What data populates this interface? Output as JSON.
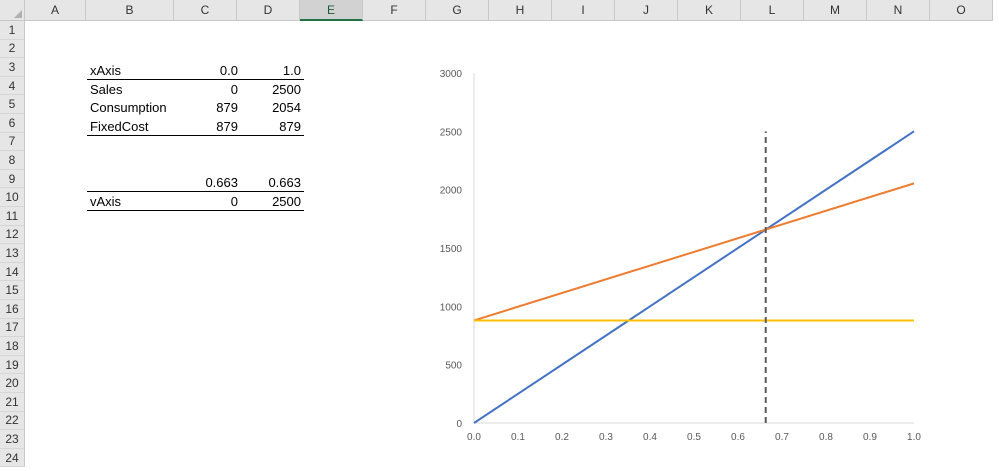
{
  "columns": [
    "A",
    "B",
    "C",
    "D",
    "E",
    "F",
    "G",
    "H",
    "I",
    "J",
    "K",
    "L",
    "M",
    "N",
    "O"
  ],
  "selected_column": "E",
  "rows": [
    "1",
    "2",
    "3",
    "4",
    "5",
    "6",
    "7",
    "8",
    "9",
    "10",
    "11",
    "12",
    "13",
    "14",
    "15",
    "16",
    "17",
    "18",
    "19",
    "20",
    "21",
    "22",
    "23",
    "24"
  ],
  "table1": {
    "rows": [
      {
        "label": "xAxis",
        "c": "0.0",
        "d": "1.0"
      },
      {
        "label": "Sales",
        "c": "0",
        "d": "2500"
      },
      {
        "label": "Consumption",
        "c": "879",
        "d": "2054"
      },
      {
        "label": "FixedCost",
        "c": "879",
        "d": "879"
      }
    ]
  },
  "table2": {
    "row9": {
      "c": "0.663",
      "d": "0.663"
    },
    "row10": {
      "label": "vAxis",
      "c": "0",
      "d": "2500"
    }
  },
  "chart_data": {
    "type": "line",
    "xlim": [
      0,
      1
    ],
    "ylim": [
      0,
      3000
    ],
    "x_ticks": [
      "0.0",
      "0.1",
      "0.2",
      "0.3",
      "0.4",
      "0.5",
      "0.6",
      "0.7",
      "0.8",
      "0.9",
      "1.0"
    ],
    "y_ticks": [
      "0",
      "500",
      "1000",
      "1500",
      "2000",
      "2500",
      "3000"
    ],
    "series": [
      {
        "x": [
          0,
          1
        ],
        "y": [
          0,
          2500
        ],
        "color": "#4472c4"
      },
      {
        "x": [
          0,
          1
        ],
        "y": [
          879,
          2054
        ],
        "color": "#ed7d31"
      },
      {
        "x": [
          0,
          1
        ],
        "y": [
          879,
          879
        ],
        "color": "#ffc000"
      },
      {
        "x": [
          0.663,
          0.663
        ],
        "y": [
          0,
          2500
        ],
        "color": "#595959",
        "dash": true
      }
    ]
  }
}
